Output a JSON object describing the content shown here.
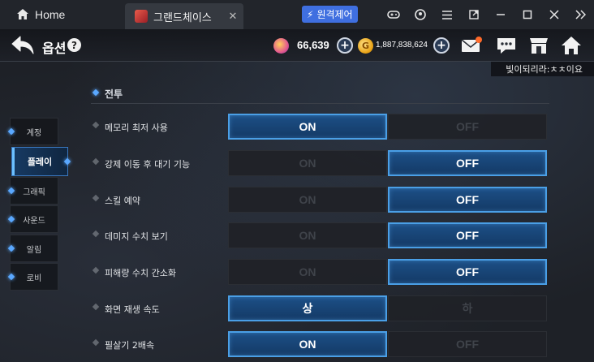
{
  "host": {
    "home_tab": "Home",
    "game_tab": "그랜드체이스",
    "remote_button": "원격제어",
    "icons": [
      "gamepad-icon",
      "account-icon",
      "menu-icon",
      "external-icon",
      "minimize-icon",
      "maximize-icon",
      "close-icon",
      "collapse-icon"
    ]
  },
  "header": {
    "title": "옵션",
    "help": "?",
    "currency_gem": "66,639",
    "currency_gold": "1,887,838,624",
    "gold_glyph": "G",
    "plus": "+"
  },
  "nickname": "빛이되리라:ㅊㅊ이요",
  "nav": {
    "items": [
      {
        "label": "계정",
        "active": false
      },
      {
        "label": "플레이",
        "active": true
      },
      {
        "label": "그래픽",
        "active": false
      },
      {
        "label": "사운드",
        "active": false
      },
      {
        "label": "알림",
        "active": false
      },
      {
        "label": "로비",
        "active": false
      }
    ]
  },
  "section": {
    "title": "전투"
  },
  "settings": [
    {
      "label": "메모리 최저 사용",
      "left": "ON",
      "right": "OFF",
      "selected": "left"
    },
    {
      "label": "강제 이동 후 대기 기능",
      "left": "ON",
      "right": "OFF",
      "selected": "right"
    },
    {
      "label": "스킬 예약",
      "left": "ON",
      "right": "OFF",
      "selected": "right"
    },
    {
      "label": "데미지 수치 보기",
      "left": "ON",
      "right": "OFF",
      "selected": "right"
    },
    {
      "label": "피해량 수치 간소화",
      "left": "ON",
      "right": "OFF",
      "selected": "right"
    },
    {
      "label": "화면 재생 속도",
      "left": "상",
      "right": "하",
      "selected": "left"
    },
    {
      "label": "필살기 2배속",
      "left": "ON",
      "right": "OFF",
      "selected": "left"
    }
  ]
}
